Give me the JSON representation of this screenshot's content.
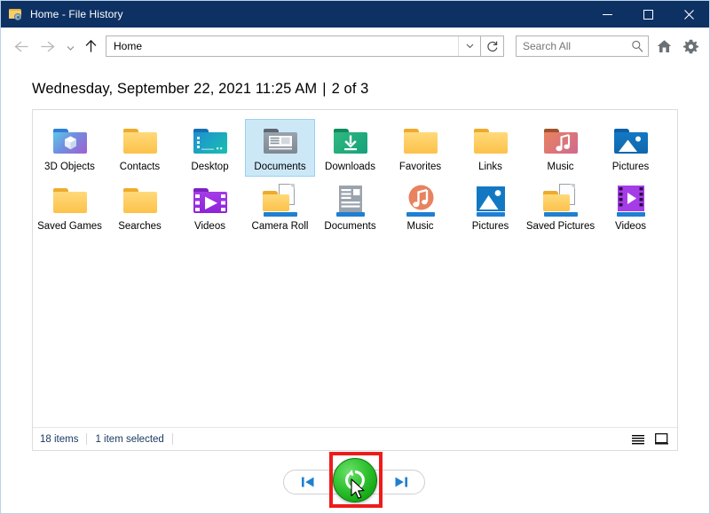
{
  "window": {
    "title": "Home - File History",
    "app_icon": "folder-clock-icon",
    "controls": {
      "minimize": "minimize-button",
      "maximize": "maximize-button",
      "close": "close-button"
    }
  },
  "navbar": {
    "back": "back-arrow",
    "forward": "forward-arrow",
    "recent": "recent-locations-chevron",
    "up": "up-arrow",
    "address_value": "Home",
    "address_chevron": "address-dropdown-chevron",
    "refresh": "refresh-icon",
    "search_placeholder": "Search All",
    "search_icon": "search-icon",
    "home_icon": "home-icon",
    "settings_icon": "gear-icon"
  },
  "header": {
    "timestamp": "Wednesday, September 22, 2021 11:25 AM",
    "separator": "|",
    "counter": "2 of 3"
  },
  "items": [
    {
      "label": "3D Objects",
      "icon": "folder-3d-objects-icon",
      "style": "c3d",
      "selected": false
    },
    {
      "label": "Contacts",
      "icon": "folder-yellow-icon",
      "style": "yellow",
      "selected": false
    },
    {
      "label": "Desktop",
      "icon": "folder-desktop-icon",
      "style": "desk",
      "selected": false
    },
    {
      "label": "Documents",
      "icon": "folder-documents-icon",
      "style": "docf",
      "selected": true
    },
    {
      "label": "Downloads",
      "icon": "folder-downloads-icon",
      "style": "dl",
      "selected": false
    },
    {
      "label": "Favorites",
      "icon": "folder-yellow-icon",
      "style": "yellow",
      "selected": false
    },
    {
      "label": "Links",
      "icon": "folder-yellow-icon",
      "style": "yellow",
      "selected": false
    },
    {
      "label": "Music",
      "icon": "folder-music-icon",
      "style": "musf",
      "selected": false
    },
    {
      "label": "Pictures",
      "icon": "folder-pictures-icon",
      "style": "picf",
      "selected": false
    },
    {
      "label": "Saved Games",
      "icon": "folder-yellow-icon",
      "style": "yellow",
      "selected": false
    },
    {
      "label": "Searches",
      "icon": "folder-yellow-icon",
      "style": "yellow",
      "selected": false
    },
    {
      "label": "Videos",
      "icon": "folder-videos-icon",
      "style": "vidf",
      "selected": false
    },
    {
      "label": "Camera Roll",
      "icon": "library-camera-roll-icon",
      "style": "libf",
      "selected": false
    },
    {
      "label": "Documents",
      "icon": "library-documents-icon",
      "style": "libd",
      "selected": false
    },
    {
      "label": "Music",
      "icon": "library-music-icon",
      "style": "libm",
      "selected": false
    },
    {
      "label": "Pictures",
      "icon": "library-pictures-icon",
      "style": "libp",
      "selected": false
    },
    {
      "label": "Saved Pictures",
      "icon": "library-saved-pictures-icon",
      "style": "libs",
      "selected": false
    },
    {
      "label": "Videos",
      "icon": "library-videos-icon",
      "style": "libv",
      "selected": false
    }
  ],
  "statusbar": {
    "item_count": "18 items",
    "selection": "1 item selected",
    "details_view_icon": "details-view-icon",
    "large-icons_view_icon": "large-icons-view-icon"
  },
  "bottom_nav": {
    "previous": "previous-version-button",
    "next": "next-version-button",
    "restore": "restore-button",
    "restore_icon": "restore-circular-arrow-icon",
    "highlight": "red-highlight-box",
    "cursor": "mouse-pointer"
  },
  "colors": {
    "titlebar": "#0e3164",
    "selection": "#cce8f7",
    "restore_green": "#33c433",
    "highlight_red": "#ee1b1b",
    "accent_blue": "#1f7fd0"
  }
}
